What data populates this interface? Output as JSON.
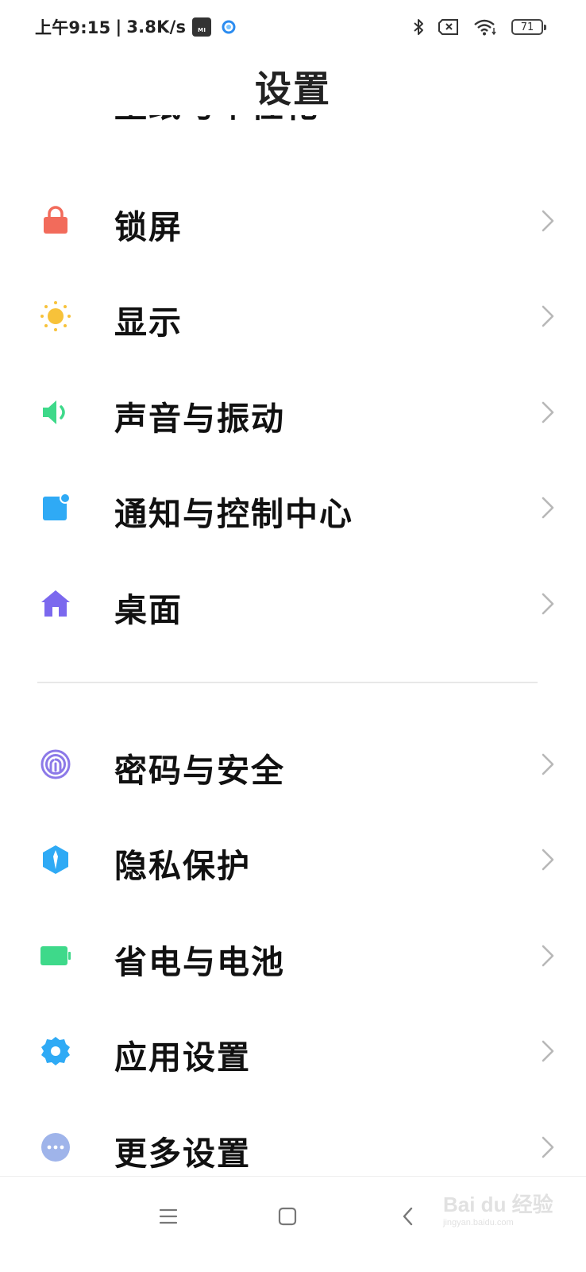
{
  "status_bar": {
    "time": "上午9:15",
    "separator": "|",
    "net_speed": "3.8K/s",
    "mi_badge": "MI",
    "battery_level": "71",
    "icons": [
      "bluetooth-icon",
      "sim-off-icon",
      "wifi-icon",
      "battery-icon"
    ]
  },
  "header": {
    "title": "设置"
  },
  "settings": {
    "items": [
      {
        "label": "壁纸与个性化",
        "icon": "wallpaper-icon",
        "color": "#2faaf5"
      },
      {
        "label": "锁屏",
        "icon": "lock-icon",
        "color": "#f26b5b"
      },
      {
        "label": "显示",
        "icon": "sun-icon",
        "color": "#f7c23a"
      },
      {
        "label": "声音与振动",
        "icon": "speaker-icon",
        "color": "#3ed98a"
      },
      {
        "label": "通知与控制中心",
        "icon": "notification-icon",
        "color": "#2faaf5"
      },
      {
        "label": "桌面",
        "icon": "home-icon",
        "color": "#7b68ee"
      },
      {
        "label": "密码与安全",
        "icon": "fingerprint-icon",
        "color": "#8c79e8"
      },
      {
        "label": "隐私保护",
        "icon": "privacy-shield-icon",
        "color": "#2faaf5"
      },
      {
        "label": "省电与电池",
        "icon": "battery-saver-icon",
        "color": "#3ed98a"
      },
      {
        "label": "应用设置",
        "icon": "gear-icon",
        "color": "#2faaf5"
      },
      {
        "label": "更多设置",
        "icon": "more-dots-icon",
        "color": "#9fb4ea"
      }
    ]
  },
  "nav_bar": {
    "icons": [
      "menu-icon",
      "home-square-icon",
      "back-icon"
    ]
  },
  "watermark": {
    "brand": "Bai du 经验",
    "url": "jingyan.baidu.com"
  }
}
